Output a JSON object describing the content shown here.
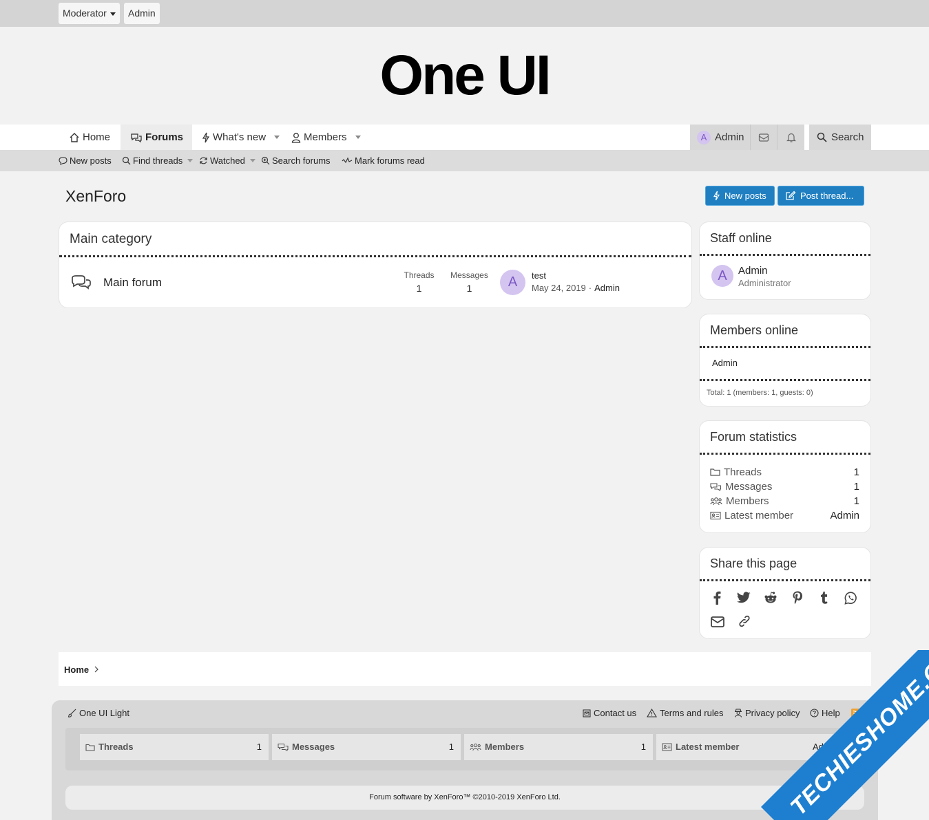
{
  "topbar": {
    "moderator": "Moderator",
    "admin": "Admin"
  },
  "logo": {
    "text": "One UI"
  },
  "nav": {
    "home": "Home",
    "forums": "Forums",
    "whats_new": "What's new",
    "members": "Members",
    "user": "Admin",
    "user_initial": "A",
    "search": "Search"
  },
  "subnav": {
    "new_posts": "New posts",
    "find_threads": "Find threads",
    "watched": "Watched",
    "search_forums": "Search forums",
    "mark_read": "Mark forums read"
  },
  "page": {
    "title": "XenForo",
    "new_posts_btn": "New posts",
    "post_thread_btn": "Post thread..."
  },
  "category": {
    "title": "Main category",
    "forum": {
      "name": "Main forum",
      "threads_label": "Threads",
      "threads": "1",
      "messages_label": "Messages",
      "messages": "1",
      "last_initial": "A",
      "last_title": "test",
      "last_date": "May 24, 2019",
      "last_sep": "·",
      "last_user": "Admin"
    }
  },
  "staff_online": {
    "title": "Staff online",
    "user": "Admin",
    "initial": "A",
    "role": "Administrator"
  },
  "members_online": {
    "title": "Members online",
    "user": "Admin",
    "total": "Total: 1 (members: 1, guests: 0)"
  },
  "forum_stats": {
    "title": "Forum statistics",
    "rows": [
      {
        "label": "Threads",
        "value": "1"
      },
      {
        "label": "Messages",
        "value": "1"
      },
      {
        "label": "Members",
        "value": "1"
      },
      {
        "label": "Latest member",
        "value": "Admin"
      }
    ]
  },
  "share": {
    "title": "Share this page",
    "icons": [
      "facebook-icon",
      "twitter-icon",
      "reddit-icon",
      "pinterest-icon",
      "tumblr-icon",
      "whatsapp-icon",
      "email-icon",
      "link-icon"
    ]
  },
  "breadcrumb": {
    "home": "Home"
  },
  "footer": {
    "style": "One UI Light",
    "contact": "Contact us",
    "terms": "Terms and rules",
    "privacy": "Privacy policy",
    "help": "Help",
    "stats": [
      {
        "label": "Threads",
        "value": "1"
      },
      {
        "label": "Messages",
        "value": "1"
      },
      {
        "label": "Members",
        "value": "1"
      },
      {
        "label": "Latest member",
        "value": "Admin"
      }
    ],
    "copyright": "Forum software by XenForo™ ©2010-2019 XenForo Ltd."
  },
  "watermark": {
    "text": "TECHIESHOME.COM"
  },
  "colors": {
    "accent": "#1f7fc1",
    "avatar_bg": "#d4c4f0",
    "avatar_fg": "#7b58c4",
    "watermark": "#1e7fd0"
  }
}
